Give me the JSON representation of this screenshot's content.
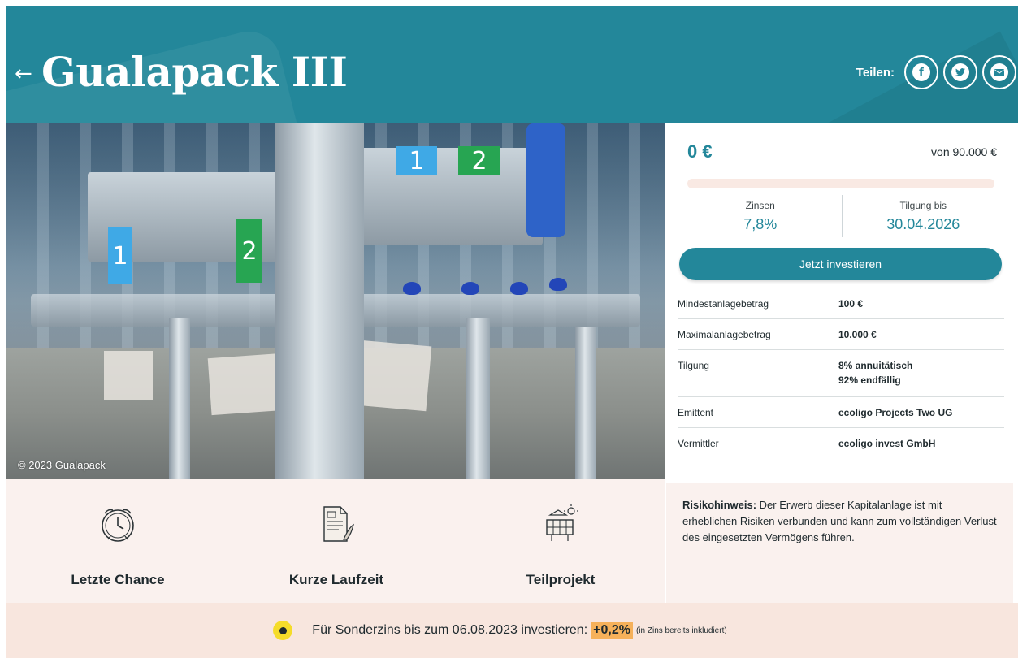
{
  "header": {
    "back_icon": "arrow-left-icon",
    "title": "Gualapack III",
    "share_label": "Teilen:",
    "share_buttons": [
      {
        "icon": "facebook-icon",
        "glyph": "f"
      },
      {
        "icon": "twitter-icon",
        "glyph": "t"
      },
      {
        "icon": "mail-icon",
        "glyph": "✉"
      }
    ]
  },
  "hero": {
    "copyright": "© 2023 Gualapack",
    "tags": [
      "1",
      "2",
      "1",
      "2"
    ]
  },
  "funding": {
    "amount": "0 €",
    "goal": "von 90.000 €",
    "progress_fraction": 0.0,
    "interest_label": "Zinsen",
    "interest_value": "7,8%",
    "repayment_label": "Tilgung bis",
    "repayment_value": "30.04.2026",
    "invest_button": "Jetzt investieren"
  },
  "details": [
    {
      "key": "Mindestanlagebetrag",
      "value": "100 €"
    },
    {
      "key": "Maximalanlagebetrag",
      "value": "10.000 €"
    },
    {
      "key": "Tilgung",
      "value": "8% annuitätisch",
      "value2": "92% endfällig"
    },
    {
      "key": "Emittent",
      "value": "ecoligo Projects Two UG"
    },
    {
      "key": "Vermittler",
      "value": "ecoligo invest GmbH"
    }
  ],
  "features": [
    {
      "icon": "clock-icon",
      "label": "Letzte Chance"
    },
    {
      "icon": "document-icon",
      "label": "Kurze Laufzeit"
    },
    {
      "icon": "solar-panel-icon",
      "label": "Teilprojekt"
    }
  ],
  "risk": {
    "title": "Risikohinweis:",
    "text": " Der Erwerb dieser Kapitalanlage ist mit erheblichen Risiken verbunden und kann zum vollständigen Verlust des eingesetzten Vermögens führen."
  },
  "banner": {
    "icon": "tag-icon",
    "text": "Für Sonderzins bis zum 06.08.2023 investieren:",
    "highlight": "+0,2%",
    "note": "(in Zins bereits inkludiert)"
  },
  "colors": {
    "brand": "#23879a",
    "panel_bg": "#faf1ee",
    "banner_bg": "#f8e6de",
    "highlight": "#f6b15a",
    "tag_dot": "#f5dc2a"
  }
}
